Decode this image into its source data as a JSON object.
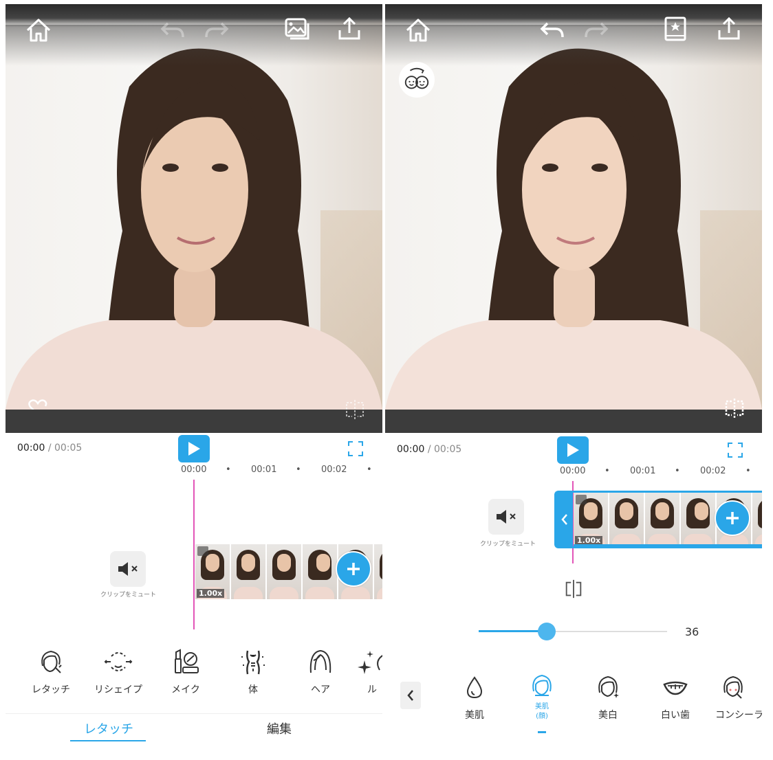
{
  "left": {
    "time": {
      "current": "00:00",
      "total": "/ 00:05"
    },
    "ruler": [
      "00:00",
      "•",
      "00:01",
      "•",
      "00:02",
      "•"
    ],
    "mute_label": "クリップをミュート",
    "speed": "1.00x",
    "tools": [
      {
        "label": "レタッチ",
        "icon": "retouch-face-icon"
      },
      {
        "label": "リシェイプ",
        "icon": "reshape-face-icon"
      },
      {
        "label": "メイク",
        "icon": "makeup-icon"
      },
      {
        "label": "体",
        "icon": "body-icon"
      },
      {
        "label": "ヘア",
        "icon": "hair-icon"
      },
      {
        "label": "ル",
        "icon": "sparkle-icon"
      }
    ],
    "tabs": [
      {
        "label": "レタッチ",
        "active": true
      },
      {
        "label": "編集",
        "active": false
      }
    ]
  },
  "right": {
    "time": {
      "current": "00:00",
      "total": "/ 00:05"
    },
    "ruler": [
      "00:00",
      "•",
      "00:01",
      "•",
      "00:02",
      "•"
    ],
    "mute_label": "クリップをミュート",
    "speed": "1.00x",
    "slider": {
      "value": "36",
      "fraction": 0.36
    },
    "subtools": [
      {
        "label": "美肌",
        "icon": "drop-icon",
        "active": false
      },
      {
        "label": "美肌",
        "sublabel": "(顔)",
        "icon": "face-skin-icon",
        "active": true
      },
      {
        "label": "美白",
        "icon": "whitening-face-icon",
        "active": false
      },
      {
        "label": "白い歯",
        "icon": "teeth-icon",
        "active": false
      },
      {
        "label": "コンシーラ",
        "icon": "concealer-icon",
        "active": false
      }
    ]
  },
  "colors": {
    "accent": "#2aa6e8",
    "playhead": "#e255b8",
    "bar": "#3c3c3c"
  }
}
